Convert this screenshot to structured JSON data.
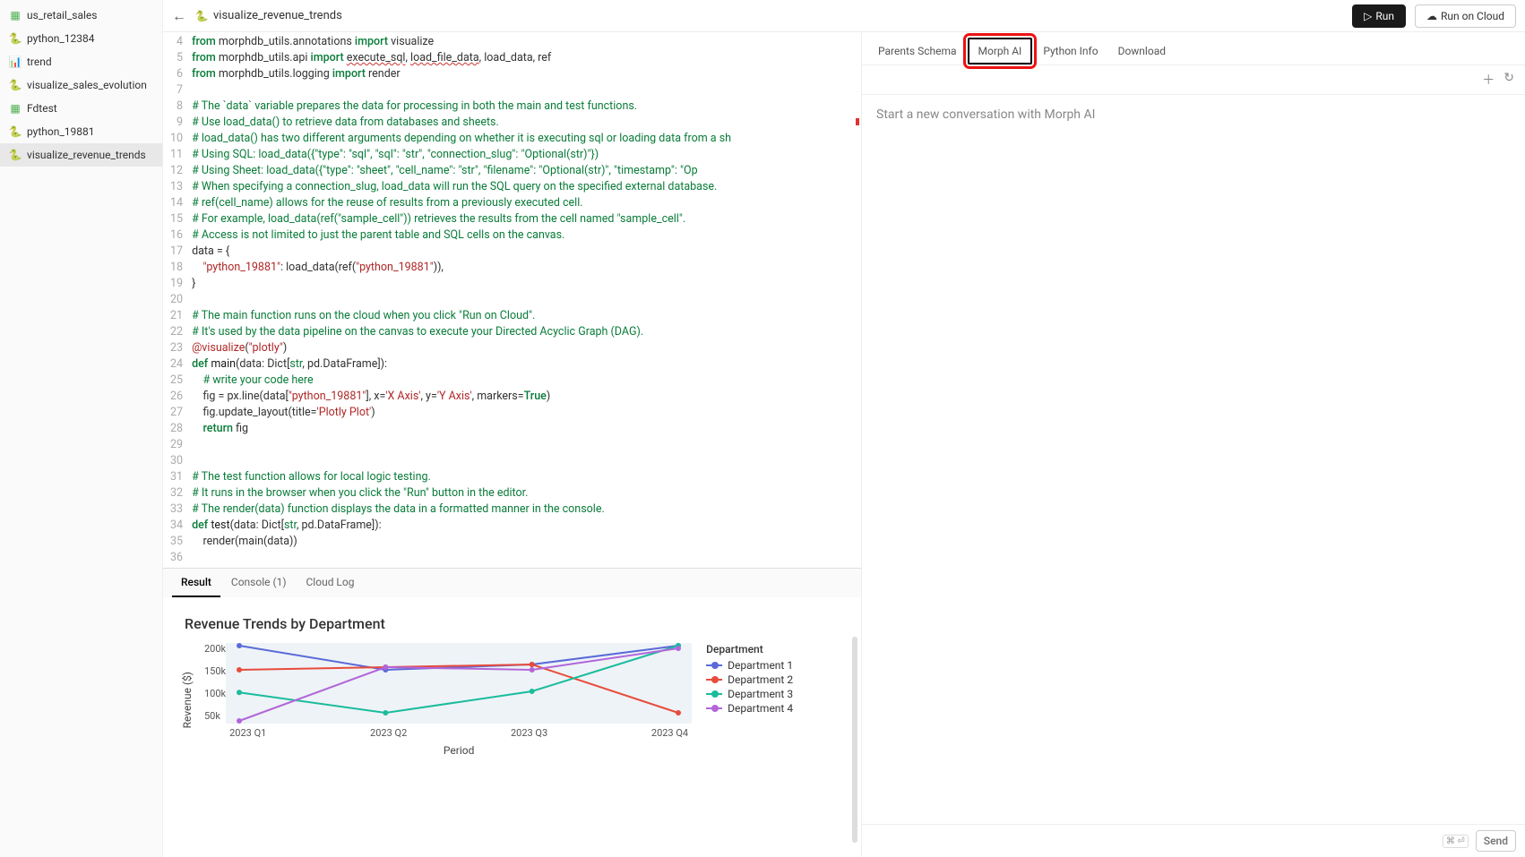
{
  "header": {
    "title": "visualize_revenue_trends",
    "run": "Run",
    "run_cloud": "Run on Cloud"
  },
  "sidebar": {
    "items": [
      {
        "icon": "table",
        "label": "us_retail_sales"
      },
      {
        "icon": "py",
        "label": "python_12384"
      },
      {
        "icon": "chart",
        "label": "trend"
      },
      {
        "icon": "py",
        "label": "visualize_sales_evolution"
      },
      {
        "icon": "table",
        "label": "Fdtest"
      },
      {
        "icon": "py",
        "label": "python_19881"
      },
      {
        "icon": "py",
        "label": "visualize_revenue_trends",
        "active": true
      }
    ]
  },
  "code": {
    "start_line": 4,
    "lines": [
      {
        "n": 4,
        "html": "<span class='c-key'>from</span> morphdb_utils.annotations <span class='c-key'>import</span> visualize"
      },
      {
        "n": 5,
        "html": "<span class='c-key'>from</span> morphdb_utils.api <span class='c-key'>import</span> <span class='wavy'>execute_sql</span>, <span class='wavy'>load_file_data</span>, load_data, ref"
      },
      {
        "n": 6,
        "html": "<span class='c-key'>from</span> morphdb_utils.logging <span class='c-key'>import</span> render"
      },
      {
        "n": 7,
        "html": ""
      },
      {
        "n": 8,
        "html": "<span class='c-cmt'># The `data` variable prepares the data for processing in both the main and test functions.</span>"
      },
      {
        "n": 9,
        "html": "<span class='c-cmt'># Use load_data() to retrieve data from databases and sheets.</span>"
      },
      {
        "n": 10,
        "html": "<span class='c-cmt'># load_data() has two different arguments depending on whether it is executing sql or loading data from a sh</span>"
      },
      {
        "n": 11,
        "html": "<span class='c-cmt'># Using SQL: load_data({\"type\": \"sql\", \"sql\": \"str\", \"connection_slug\": \"Optional(str)\"})</span>"
      },
      {
        "n": 12,
        "html": "<span class='c-cmt'># Using Sheet: load_data({\"type\": \"sheet\", \"cell_name\": \"str\", \"filename\": \"Optional(str)\", \"timestamp\": \"Op</span>"
      },
      {
        "n": 13,
        "html": "<span class='c-cmt'># When specifying a connection_slug, load_data will run the SQL query on the specified external database.</span>"
      },
      {
        "n": 14,
        "html": "<span class='c-cmt'># ref(cell_name) allows for the reuse of results from a previously executed cell.</span>"
      },
      {
        "n": 15,
        "html": "<span class='c-cmt'># For example, load_data(ref(\"sample_cell\")) retrieves the results from the cell named \"sample_cell\".</span>"
      },
      {
        "n": 16,
        "html": "<span class='c-cmt'># Access is not limited to just the parent table and SQL cells on the canvas.</span>"
      },
      {
        "n": 17,
        "html": "data = {"
      },
      {
        "n": 18,
        "html": "    <span class='c-str'>\"python_19881\"</span>: load_data(ref(<span class='c-str'>\"python_19881\"</span>)),"
      },
      {
        "n": 19,
        "html": "}"
      },
      {
        "n": 20,
        "html": ""
      },
      {
        "n": 21,
        "html": "<span class='c-cmt'># The main function runs on the cloud when you click \"Run on Cloud\".</span>"
      },
      {
        "n": 22,
        "html": "<span class='c-cmt'># It's used by the data pipeline on the canvas to execute your Directed Acyclic Graph (DAG).</span>"
      },
      {
        "n": 23,
        "html": "<span class='c-dec'>@visualize</span>(<span class='c-str'>\"plotly\"</span>)"
      },
      {
        "n": 24,
        "html": "<span class='c-key'>def</span> <span class='c-fn'>main</span>(data: Dict[<span class='c-type'>str</span>, pd.DataFrame]):"
      },
      {
        "n": 25,
        "html": "    <span class='c-cmt'># write your code here</span>"
      },
      {
        "n": 26,
        "html": "    fig = px.line(data[<span class='c-str'>\"python_19881\"</span>], x=<span class='c-str'>'X Axis'</span>, y=<span class='c-str'>'Y Axis'</span>, markers=<span class='c-key'>True</span>)"
      },
      {
        "n": 27,
        "html": "    fig.update_layout(title=<span class='c-str'>'Plotly Plot'</span>)"
      },
      {
        "n": 28,
        "html": "    <span class='c-key'>return</span> fig"
      },
      {
        "n": 29,
        "html": ""
      },
      {
        "n": 30,
        "html": ""
      },
      {
        "n": 31,
        "html": "<span class='c-cmt'># The test function allows for local logic testing.</span>"
      },
      {
        "n": 32,
        "html": "<span class='c-cmt'># It runs in the browser when you click the \"Run\" button in the editor.</span>"
      },
      {
        "n": 33,
        "html": "<span class='c-cmt'># The render(data) function displays the data in a formatted manner in the console.</span>"
      },
      {
        "n": 34,
        "html": "<span class='c-key'>def</span> <span class='c-fn'>test</span>(data: Dict[<span class='c-type'>str</span>, pd.DataFrame]):"
      },
      {
        "n": 35,
        "html": "    render(main(data))"
      },
      {
        "n": 36,
        "html": ""
      }
    ]
  },
  "bottom_tabs": {
    "result": "Result",
    "console": "Console (1)",
    "cloud": "Cloud Log"
  },
  "right": {
    "tabs": {
      "parents": "Parents Schema",
      "morph": "Morph AI",
      "python": "Python Info",
      "download": "Download"
    },
    "placeholder": "Start a new conversation with Morph AI",
    "send": "Send"
  },
  "chart_data": {
    "type": "line",
    "title": "Revenue Trends by Department",
    "xlabel": "Period",
    "ylabel": "Revenue ($)",
    "categories": [
      "2023 Q1",
      "2023 Q2",
      "2023 Q3",
      "2023 Q4"
    ],
    "ylim": [
      50000,
      200000
    ],
    "y_ticks": [
      "200k",
      "150k",
      "100k",
      "50k"
    ],
    "legend_title": "Department",
    "series": [
      {
        "name": "Department 1",
        "color": "#5a6bd8",
        "values": [
          195000,
          150000,
          160000,
          195000
        ]
      },
      {
        "name": "Department 2",
        "color": "#e74c3c",
        "values": [
          150000,
          155000,
          160000,
          70000
        ]
      },
      {
        "name": "Department 3",
        "color": "#1abc9c",
        "values": [
          108000,
          70000,
          110000,
          195000
        ]
      },
      {
        "name": "Department 4",
        "color": "#b266d9",
        "values": [
          55000,
          155000,
          150000,
          190000
        ]
      }
    ]
  }
}
